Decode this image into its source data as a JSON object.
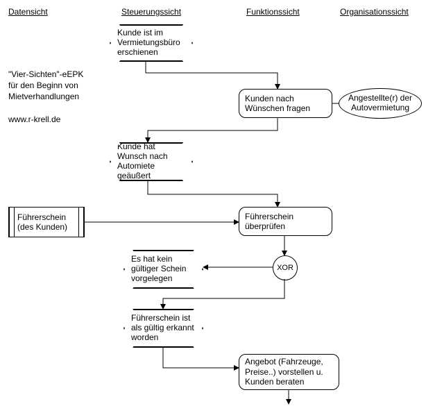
{
  "headers": {
    "data": "Datensicht",
    "control": "Steuerungssicht",
    "function": "Funktionssicht",
    "org": "Organisationssicht"
  },
  "sidetext": {
    "title1": "\"Vier-Sichten\"-eEPK",
    "title2": "für den Beginn von",
    "title3": "Mietverhandlungen",
    "url": "www.r-krell.de"
  },
  "events": {
    "e1": "Kunde ist im Vermietungsbüro erschienen",
    "e2": "Kunde hat Wunsch nach Automiete geäußert",
    "e3": "Es hat kein gültiger Schein vorgelegen",
    "e4": "Führerschein ist als gültig erkannt worden"
  },
  "functions": {
    "f1": "Kunden nach Wünschen fragen",
    "f2": "Führerschein überprüfen",
    "f3": "Angebot (Fahrzeuge, Preise..) vorstellen u. Kunden beraten"
  },
  "org": {
    "o1": "Angestellte(r) der Autovermietung"
  },
  "data": {
    "d1": "Führerschein (des Kunden)"
  },
  "connector": {
    "xor": "XOR"
  }
}
